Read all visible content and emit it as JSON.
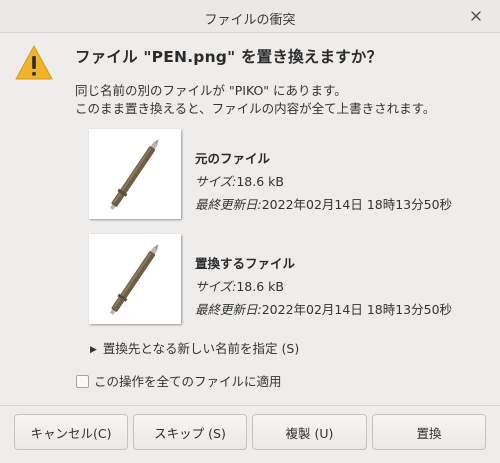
{
  "window": {
    "title": "ファイルの衝突"
  },
  "dialog": {
    "heading": "ファイル \"PEN.png\" を置き換えますか？",
    "line1": "同じ名前の別のファイルが \"PIKO\" にあります。",
    "line2": "このまま置き換えると、ファイルの内容が全て上書きされます。"
  },
  "original": {
    "title": "元のファイル",
    "size_label": "サイズ:",
    "size_value": "18.6 kB",
    "modified_label": "最終更新日:",
    "modified_value": "2022年02月14日 18時13分50秒"
  },
  "replacement": {
    "title": "置換するファイル",
    "size_label": "サイズ:",
    "size_value": "18.6 kB",
    "modified_label": "最終更新日:",
    "modified_value": "2022年02月14日 18時13分50秒"
  },
  "expander": {
    "label": "置換先となる新しい名前を指定 (S)"
  },
  "apply_all": {
    "label": "この操作を全てのファイルに適用",
    "checked": false
  },
  "buttons": {
    "cancel": "キャンセル(C)",
    "skip": "スキップ (S)",
    "copy": "複製 (U)",
    "replace": "置換"
  },
  "colors": {
    "warning": "#f0b32a",
    "pen_body": "#6d5f47"
  },
  "icons": {
    "warning": "warning-icon",
    "close": "close-icon",
    "expander": "triangle-right-icon"
  }
}
